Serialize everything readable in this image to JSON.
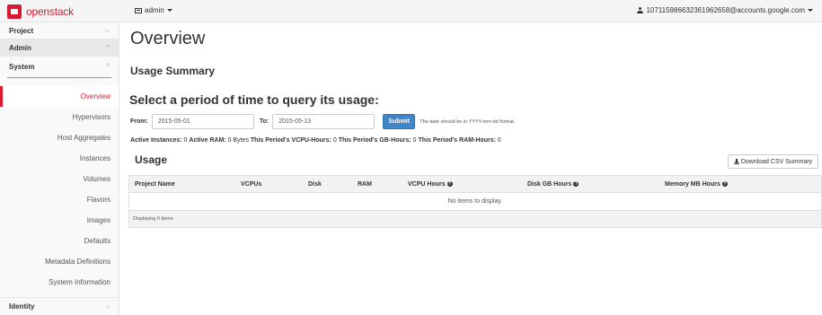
{
  "navbar": {
    "brand": "openstack",
    "project": "admin",
    "user": "107115986632361962658@accounts.google.com"
  },
  "sidebar": {
    "project_label": "Project",
    "admin_label": "Admin",
    "system_label": "System",
    "items": [
      {
        "label": "Overview",
        "active": true
      },
      {
        "label": "Hypervisors"
      },
      {
        "label": "Host Aggregates"
      },
      {
        "label": "Instances"
      },
      {
        "label": "Volumes"
      },
      {
        "label": "Flavors"
      },
      {
        "label": "Images"
      },
      {
        "label": "Defaults"
      },
      {
        "label": "Metadata Definitions"
      },
      {
        "label": "System Information"
      }
    ],
    "identity_label": "Identity",
    "chevron_down": "⌵",
    "chevron_up": "^"
  },
  "main": {
    "title": "Overview",
    "usage_summary": "Usage Summary",
    "period_title": "Select a period of time to query its usage:",
    "form": {
      "from_label": "From:",
      "from_value": "2015-05-01",
      "to_label": "To:",
      "to_value": "2015-05-13",
      "submit_label": "Submit",
      "hint": "The date should be in YYYY-mm-dd format."
    },
    "stats": {
      "active_instances_label": "Active Instances:",
      "active_instances_value": "0",
      "active_ram_label": "Active RAM:",
      "active_ram_value": "0 Bytes",
      "vcpu_hours_label": "This Period's VCPU-Hours:",
      "vcpu_hours_value": "0",
      "gb_hours_label": "This Period's GB-Hours:",
      "gb_hours_value": "0",
      "ram_hours_label": "This Period's RAM-Hours:",
      "ram_hours_value": "0"
    },
    "usage_heading": "Usage",
    "csv_button": "Download CSV Summary",
    "table": {
      "columns": [
        "Project Name",
        "VCPUs",
        "Disk",
        "RAM",
        "VCPU Hours",
        "Disk GB Hours",
        "Memory MB Hours"
      ],
      "empty_message": "No items to display.",
      "footer": "Displaying 0 items"
    }
  }
}
